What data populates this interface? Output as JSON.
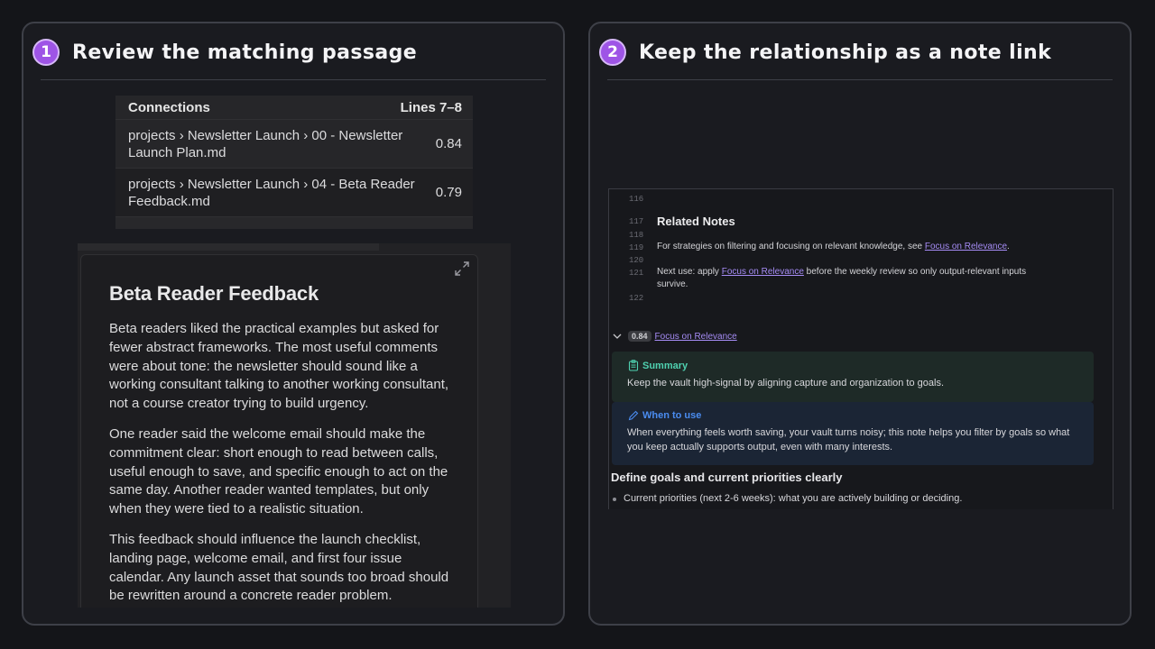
{
  "step1": {
    "number": "1",
    "title": "Review the matching passage",
    "connections": {
      "header": "Connections",
      "range": "Lines 7–8",
      "rows": [
        {
          "path": "projects › Newsletter Launch › 00 - Newsletter Launch Plan.md",
          "score": "0.84"
        },
        {
          "path": "projects › Newsletter Launch › 04 - Beta Reader Feedback.md",
          "score": "0.79"
        }
      ]
    },
    "preview": {
      "title": "Beta Reader Feedback",
      "paragraphs": [
        "Beta readers liked the practical examples but asked for fewer abstract frameworks. The most useful comments were about tone: the newsletter should sound like a working consultant talking to another working consultant, not a course creator trying to build urgency.",
        "One reader said the welcome email should make the commitment clear: short enough to read between calls, useful enough to save, and specific enough to act on the same day. Another reader wanted templates, but only when they were tied to a realistic situation.",
        "This feedback should influence the launch checklist, landing page, welcome email, and first four issue calendar. Any launch asset that sounds too broad should be rewritten around a concrete reader problem."
      ]
    }
  },
  "step2": {
    "number": "2",
    "title": "Keep the relationship as a note link",
    "editor": {
      "line_numbers": [
        "116",
        "117",
        "118",
        "119",
        "120",
        "121",
        "122"
      ],
      "heading": "Related Notes",
      "line119_prefix": "For strategies on filtering and focusing on relevant knowledge, see ",
      "line119_link": "Focus on Relevance",
      "line119_suffix": ".",
      "line121_prefix": "Next use: apply ",
      "line121_link": "Focus on Relevance",
      "line121_suffix": " before the weekly review so only output-relevant inputs",
      "line121_cont": "survive.",
      "related": {
        "score": "0.84",
        "link": "Focus on Relevance"
      },
      "summary": {
        "label": "Summary",
        "text": "Keep the vault high-signal by aligning capture and organization to goals.",
        "color": "#4fd1b0"
      },
      "when": {
        "label": "When to use",
        "text": "When everything feels worth saving, your vault turns noisy; this note helps you filter by goals so what you keep actually supports output, even with many interests.",
        "color": "#4a8cf0"
      },
      "section_heading": "Define goals and current priorities clearly",
      "bullet": "Current priorities (next 2-6 weeks): what you are actively building or deciding."
    }
  }
}
